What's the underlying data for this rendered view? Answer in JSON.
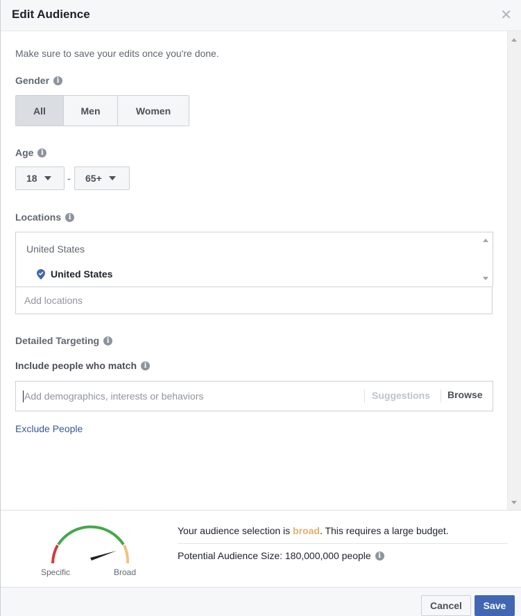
{
  "dialog": {
    "title": "Edit Audience",
    "close_icon": "close-icon",
    "hint": "Make sure to save your edits once you're done."
  },
  "gender": {
    "label": "Gender",
    "options": [
      "All",
      "Men",
      "Women"
    ],
    "selected": "All"
  },
  "age": {
    "label": "Age",
    "min": "18",
    "separator": "-",
    "max": "65+"
  },
  "locations": {
    "label": "Locations",
    "group": "United States",
    "items": [
      "United States"
    ],
    "placeholder": "Add locations"
  },
  "targeting": {
    "label": "Detailed Targeting",
    "include_label": "Include people who match",
    "placeholder": "Add demographics, interests or behaviors",
    "suggestions": "Suggestions",
    "browse": "Browse",
    "exclude": "Exclude People"
  },
  "audience": {
    "summary_prefix": "Your audience selection is ",
    "summary_level": "broad",
    "summary_suffix": ". This requires a large budget.",
    "potential": "Potential Audience Size: 180,000,000 people",
    "gauge_specific": "Specific",
    "gauge_broad": "Broad",
    "gauge_level": 0.92
  },
  "footer": {
    "cancel": "Cancel",
    "save": "Save"
  },
  "colors": {
    "primary": "#4267b2",
    "link": "#365899",
    "broad": "#e2b06e",
    "gauge_green": "#42a84a",
    "gauge_red": "#d23b3b",
    "gauge_orange": "#f1c27d"
  }
}
